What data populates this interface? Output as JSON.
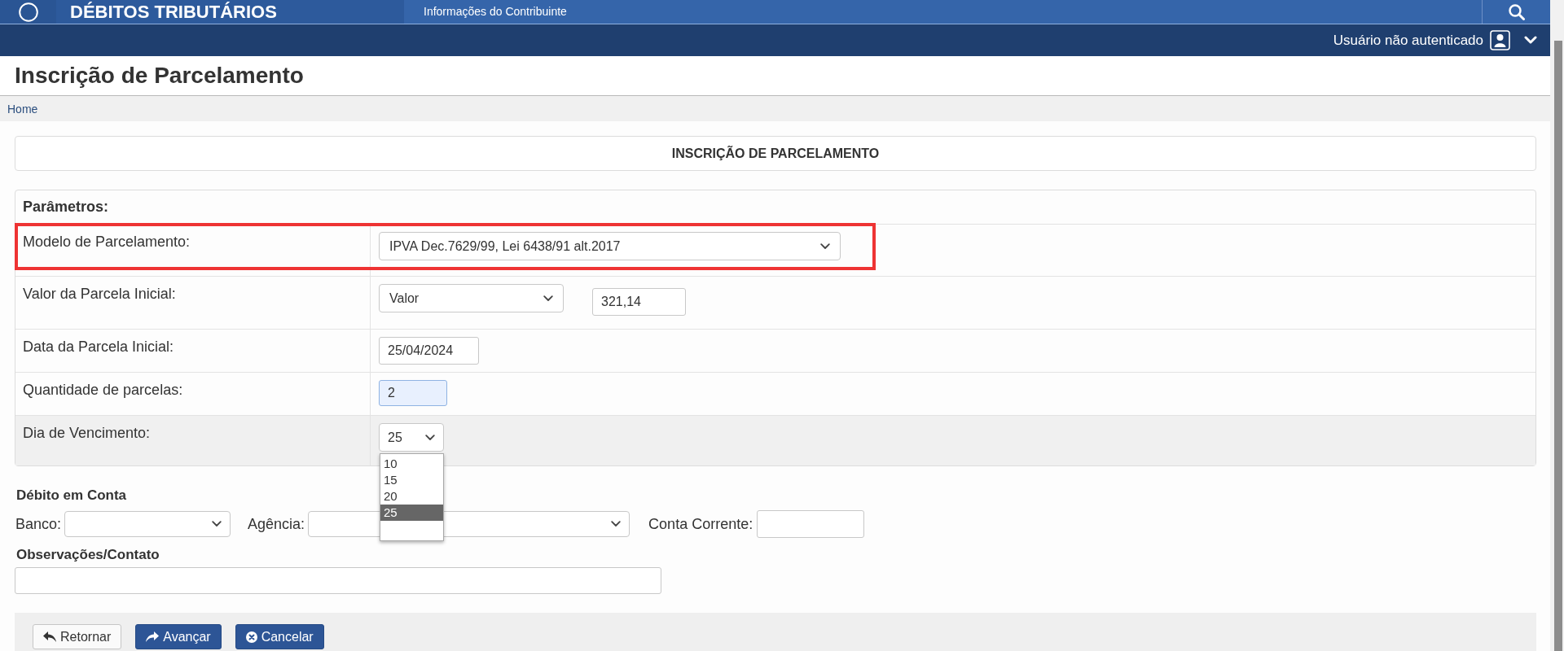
{
  "header": {
    "title": "DÉBITOS TRIBUTÁRIOS",
    "subtitle": "Informações do Contribuinte"
  },
  "user_bar": {
    "status": "Usuário não autenticado"
  },
  "page": {
    "title": "Inscrição de Parcelamento",
    "breadcrumb": [
      "Home"
    ]
  },
  "form": {
    "title": "INSCRIÇÃO DE PARCELAMENTO",
    "parameters": {
      "heading": "Parâmetros:",
      "rows": [
        {
          "label": "Modelo de Parcelamento:",
          "annotated": true,
          "hovered": false,
          "controls": [
            {
              "kind": "select",
              "value": "IPVA Dec.7629/99, Lei 6438/91 alt.2017",
              "focused": false
            }
          ]
        },
        {
          "label": "Valor da Parcela Inicial:",
          "annotated": false,
          "hovered": false,
          "controls": [
            {
              "kind": "select",
              "value": "Valor",
              "focused": false
            },
            {
              "kind": "input",
              "value": "321,14",
              "focused": false
            }
          ]
        },
        {
          "label": "Data da Parcela Inicial:",
          "annotated": false,
          "hovered": false,
          "controls": [
            {
              "kind": "input",
              "value": "25/04/2024",
              "focused": false
            }
          ]
        },
        {
          "label": "Quantidade de parcelas:",
          "annotated": false,
          "hovered": false,
          "controls": [
            {
              "kind": "input",
              "value": "2",
              "focused": true
            }
          ]
        },
        {
          "label": "Dia de Vencimento:",
          "annotated": false,
          "hovered": true,
          "controls": [
            {
              "kind": "select",
              "value": "25",
              "focused": false,
              "expanded": true,
              "options": [
                {
                  "label": "10",
                  "selected": false
                },
                {
                  "label": "15",
                  "selected": false
                },
                {
                  "label": "20",
                  "selected": false
                },
                {
                  "label": "25",
                  "selected": true
                }
              ]
            }
          ]
        }
      ]
    },
    "debit": {
      "heading": "Débito em Conta",
      "fields": [
        {
          "label": "Banco:",
          "kind": "select"
        },
        {
          "label": "Agência:",
          "kind": "select"
        },
        {
          "label": "Conta Corrente:",
          "kind": "input"
        }
      ]
    },
    "notes": {
      "heading": "Observações/Contato"
    },
    "actions": [
      {
        "label": "Retornar",
        "kind": "back"
      },
      {
        "label": "Avançar",
        "kind": "next"
      },
      {
        "label": "Cancelar",
        "kind": "cancel"
      }
    ]
  }
}
